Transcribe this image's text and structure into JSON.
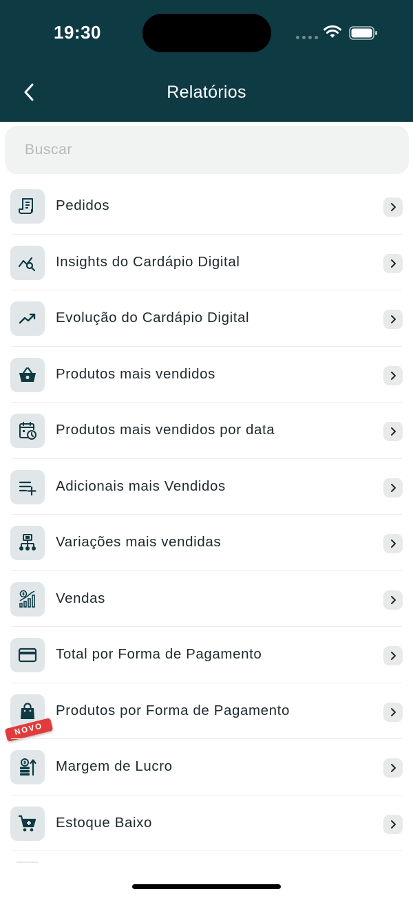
{
  "status": {
    "time": "19:30"
  },
  "header": {
    "title": "Relatórios",
    "back_icon": "chevron-left-icon"
  },
  "search": {
    "placeholder": "Buscar",
    "value": ""
  },
  "items": [
    {
      "label": "Pedidos",
      "icon": "receipt-icon"
    },
    {
      "label": "Insights do Cardápio Digital",
      "icon": "chart-search-icon"
    },
    {
      "label": "Evolução do Cardápio Digital",
      "icon": "trending-up-icon"
    },
    {
      "label": "Produtos mais vendidos",
      "icon": "basket-icon"
    },
    {
      "label": "Produtos mais vendidos por data",
      "icon": "calendar-clock-icon"
    },
    {
      "label": "Adicionais mais Vendidos",
      "icon": "playlist-add-icon"
    },
    {
      "label": "Variações mais vendidas",
      "icon": "hierarchy-icon"
    },
    {
      "label": "Vendas",
      "icon": "sales-chart-icon"
    },
    {
      "label": "Total por Forma de Pagamento",
      "icon": "credit-card-icon"
    },
    {
      "label": "Produtos por Forma de Pagamento",
      "icon": "shopping-bag-icon",
      "badge": "NOVO"
    },
    {
      "label": "Margem de Lucro",
      "icon": "profit-coins-icon"
    },
    {
      "label": "Estoque Baixo",
      "icon": "cart-icon"
    }
  ],
  "colors": {
    "header_bg": "#0e3a44",
    "icon_bg": "#e1e7e8",
    "icon_fg": "#0e3a44",
    "badge_bg": "#e23b3b"
  }
}
